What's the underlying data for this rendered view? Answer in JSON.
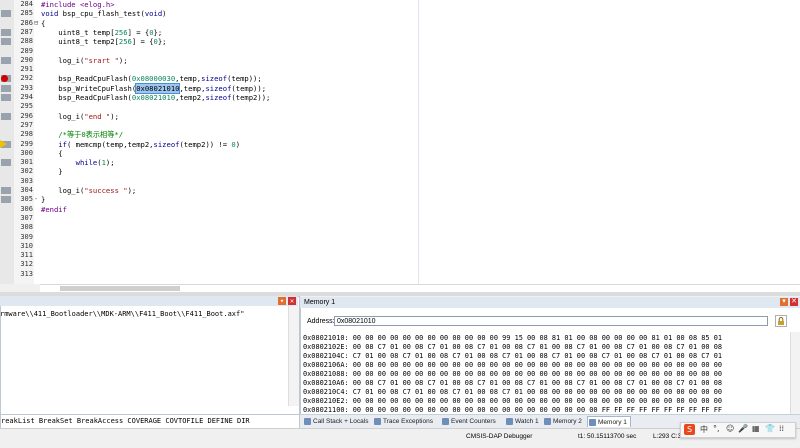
{
  "editor": {
    "lines": [
      {
        "no": "284",
        "html": "<span class=\"pp\">#include &lt;elog.h&gt;</span>"
      },
      {
        "no": "285",
        "html": "<span class=\"kw\">void</span> bsp_cpu_flash_test(<span class=\"kw\">void</span>)"
      },
      {
        "no": "286",
        "html": "{"
      },
      {
        "no": "287",
        "html": "    uint8_t temp[<span class=\"num\">256</span>] = {<span class=\"num\">0</span>};"
      },
      {
        "no": "288",
        "html": "    uint8_t temp2[<span class=\"num\">256</span>] = {<span class=\"num\">0</span>};"
      },
      {
        "no": "289",
        "html": ""
      },
      {
        "no": "290",
        "html": "    log_i(<span class=\"str\">\"srart \"</span>);"
      },
      {
        "no": "291",
        "html": ""
      },
      {
        "no": "292",
        "html": "    bsp_ReadCpuFlash(<span class=\"num\">0x08000030</span>,temp,<span class=\"kw\">sizeof</span>(temp));"
      },
      {
        "no": "293",
        "html": "    bsp_WriteCpuFlash(<span class=\"sel\">0x08021010</span>,temp,<span class=\"kw\">sizeof</span>(temp));"
      },
      {
        "no": "294",
        "html": "    bsp_ReadCpuFlash(<span class=\"num\">0x08021010</span>,temp2,<span class=\"kw\">sizeof</span>(temp2));"
      },
      {
        "no": "295",
        "html": ""
      },
      {
        "no": "296",
        "html": "    log_i(<span class=\"str\">\"end \"</span>);"
      },
      {
        "no": "297",
        "html": ""
      },
      {
        "no": "298",
        "html": "    <span class=\"cm\">/*等于0表示相等*/</span>"
      },
      {
        "no": "299",
        "html": "    <span class=\"kw\">if</span>( memcmp(temp,temp2,<span class=\"kw\">sizeof</span>(temp2)) != <span class=\"num\">0</span>)"
      },
      {
        "no": "300",
        "html": "    {"
      },
      {
        "no": "301",
        "html": "        <span class=\"kw\">while</span>(<span class=\"num\">1</span>);"
      },
      {
        "no": "302",
        "html": "    }"
      },
      {
        "no": "303",
        "html": ""
      },
      {
        "no": "304",
        "html": "    log_i(<span class=\"str\">\"success \"</span>);"
      },
      {
        "no": "305",
        "html": "}"
      },
      {
        "no": "306",
        "html": "<span class=\"pp\">#endif</span>"
      },
      {
        "no": "307",
        "html": ""
      },
      {
        "no": "308",
        "html": ""
      },
      {
        "no": "309",
        "html": ""
      },
      {
        "no": "310",
        "html": ""
      },
      {
        "no": "311",
        "html": ""
      },
      {
        "no": "312",
        "html": ""
      },
      {
        "no": "313",
        "html": ""
      }
    ],
    "breakpoint_line": "292",
    "current_line": "299"
  },
  "command": {
    "output": "rmware\\\\411_Bootloader\\\\MDK-ARM\\\\F411_Boot\\\\F411_Boot.axf\"",
    "input": "reakList BreakSet BreakAccess COVERAGE COVTOFILE DEFINE DIR"
  },
  "memory": {
    "title": "Memory 1",
    "address_label": "Address:",
    "address_value": "0x08021010",
    "rows": [
      "0x08021010: 00 00 00 00 00 00 00 00 00 00 00 00 99 15 00 08 81 01 00 08 00 00 00 00 81 01 00 08 85 01",
      "0x0802102E: 00 08 C7 01 00 08 C7 01 00 08 C7 01 00 08 C7 01 00 08 C7 01 00 08 C7 01 00 08 C7 01 00 08",
      "0x0802104C: C7 01 00 08 C7 01 00 08 C7 01 00 08 C7 01 00 08 C7 01 00 08 C7 01 00 08 C7 01 00 08 C7 01",
      "0x0802106A: 00 08 00 00 00 00 00 00 00 00 00 00 00 00 00 00 00 00 00 00 00 00 00 00 00 00 00 00 00 00",
      "0x08021088: 00 00 00 00 00 00 00 00 00 00 00 00 00 00 00 00 00 00 00 00 00 00 00 00 00 00 00 00 00 00",
      "0x080210A6: 00 08 C7 01 00 08 C7 01 00 08 C7 01 00 08 C7 01 00 08 C7 01 00 08 C7 01 00 08 C7 01 00 08",
      "0x080210C4: C7 01 00 08 C7 01 00 08 C7 01 00 08 C7 01 00 08 00 00 00 00 00 00 00 00 00 00 00 00 00 00",
      "0x080210E2: 00 00 00 00 00 00 00 00 00 00 00 00 00 00 00 00 00 00 00 00 00 00 00 00 00 00 00 00 00 00",
      "0x08021100: 00 00 00 00 00 00 00 00 00 00 00 00 00 00 00 00 00 00 00 00 FF FF FF FF FF FF FF FF FF FF"
    ]
  },
  "tabs": [
    {
      "label": "Call Stack + Locals",
      "active": false
    },
    {
      "label": "Trace Exceptions",
      "active": false
    },
    {
      "label": "Event Counters",
      "active": false
    },
    {
      "label": "Watch 1",
      "active": false
    },
    {
      "label": "Memory 2",
      "active": false
    },
    {
      "label": "Memory 1",
      "active": true
    }
  ],
  "status": {
    "debugger": "CMSIS-DAP Debugger",
    "time": "t1: 50.15113700 sec",
    "position": "L:293 C:33"
  },
  "ime": {
    "lang": "中",
    "punct": "°,",
    "emoji": "☺",
    "mic": "🎤",
    "kbd": "▦",
    "shirt": "👕",
    "grid": "⁞⁞"
  },
  "colors": {
    "accent": "#dfe7f1",
    "selection": "#9ec6ef",
    "breakpoint": "#d00000",
    "current": "#f0c000"
  }
}
